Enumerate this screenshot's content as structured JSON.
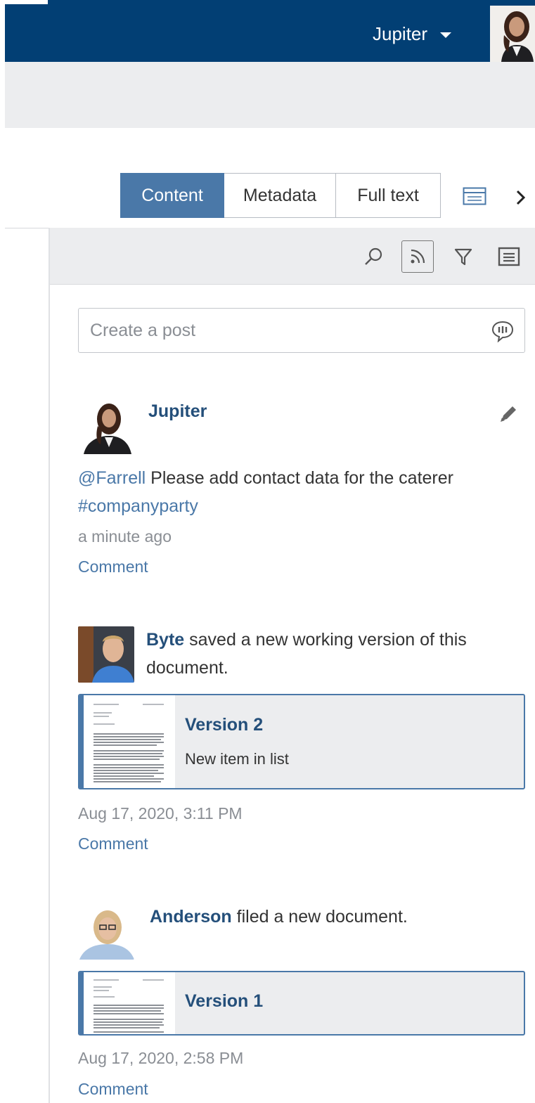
{
  "header": {
    "user_name": "Jupiter"
  },
  "tabs": [
    {
      "label": "Content",
      "active": true
    },
    {
      "label": "Metadata",
      "active": false
    },
    {
      "label": "Full text",
      "active": false
    }
  ],
  "post_input": {
    "placeholder": "Create a post"
  },
  "feed": [
    {
      "author": "Jupiter",
      "mention": "@Farrell",
      "text": " Please add contact data for the caterer",
      "hashtag": "#companyparty",
      "time": "a minute ago",
      "comment_label": "Comment"
    },
    {
      "author": "Byte",
      "action": " saved a new working version of this document.",
      "version_title": "Version 2",
      "version_description": "New item in list",
      "time": "Aug 17, 2020, 3:11 PM",
      "comment_label": "Comment"
    },
    {
      "author": "Anderson",
      "action": " filed a new document.",
      "version_title": "Version 1",
      "time": "Aug 17, 2020, 2:58 PM",
      "comment_label": "Comment"
    }
  ],
  "icons": {
    "header": [
      "caret-down-icon",
      "user-avatar"
    ],
    "tabs_extra": [
      "view-layout-icon",
      "chevron-right-icon"
    ],
    "toolbar": [
      "search-icon",
      "rss-feed-icon",
      "filter-icon",
      "list-icon"
    ],
    "post": [
      "speech-bubble-icon",
      "pencil-icon"
    ]
  },
  "colors": {
    "header_bg": "#023f74",
    "accent": "#4a78a8",
    "author": "#244f7a",
    "toolbar_bg": "#ecedef"
  }
}
